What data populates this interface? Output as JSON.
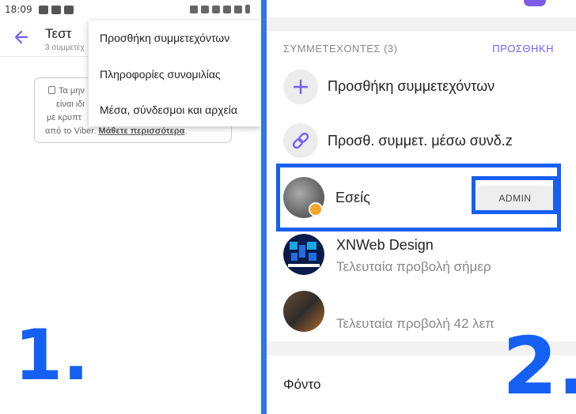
{
  "status_bar": {
    "time": "18:09"
  },
  "left_panel": {
    "chat_title": "Τεστ",
    "chat_subtitle": "3 συμμετέχ",
    "menu": [
      {
        "label": "Προσθήκη συμμετεχόντων"
      },
      {
        "label": "Πληροφορίες συνομιλίας"
      },
      {
        "label": "Μέσα, σύνδεσμοι και αρχεία"
      }
    ],
    "info_card": {
      "line1": "Τα μην",
      "line2": "είναι ιδι",
      "line3": "με κρυπτ",
      "line4_prefix": "από το Viber. ",
      "learn_more": "Μάθετε περισσότερα",
      "line4_suffix": "."
    },
    "step_number": "1."
  },
  "right_panel": {
    "section_title": "ΣΥΜΜΕΤΕΧΟΝΤΕΣ (3)",
    "section_action": "ΠΡΟΣΘΗΚΗ",
    "add_participants": "Προσθήκη συμμετεχόντων",
    "add_via_link": "Προσθ. συμμετ. μέσω συνδ.z",
    "participants": [
      {
        "name": "Εσείς",
        "role": "ADMIN"
      },
      {
        "name": "XNWeb Design",
        "status": "Τελευταία προβολή σήμερ"
      },
      {
        "name": "",
        "status": "Τελευταία προβολή 42 λεπ"
      }
    ],
    "background_label": "Φόντο",
    "step_number": "2."
  },
  "colors": {
    "accent": "#7360f2",
    "highlight": "#1560f2",
    "divider": "#2f77e6"
  }
}
